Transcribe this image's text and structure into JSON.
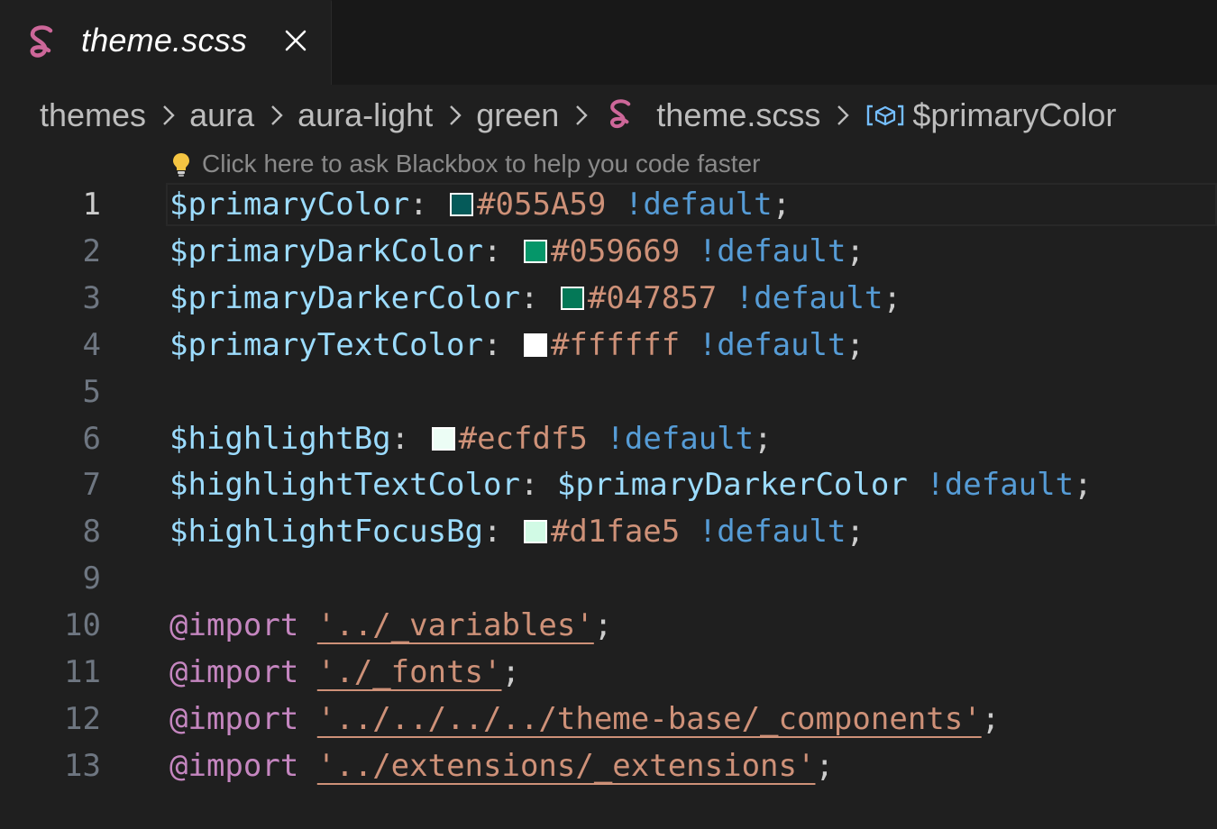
{
  "tab": {
    "title": "theme.scss"
  },
  "breadcrumb": {
    "items": [
      "themes",
      "aura",
      "aura-light",
      "green",
      "theme.scss",
      "$primaryColor"
    ]
  },
  "hint": {
    "text": "Click here to ask Blackbox to help you code faster"
  },
  "colors": {
    "sass_pink": "#cd6799",
    "variable": "#9cdcfe",
    "number": "#ce9178",
    "keyword": "#569cd6",
    "at_rule": "#c586c0"
  },
  "editor": {
    "current_line": 1,
    "lines": [
      {
        "n": "1",
        "var": "$primaryColor",
        "colon": ":",
        "swatch": "#055A59",
        "value": "#055A59",
        "flag": "!default",
        "semi": ";"
      },
      {
        "n": "2",
        "var": "$primaryDarkColor",
        "colon": ":",
        "swatch": "#059669",
        "value": "#059669",
        "flag": "!default",
        "semi": ";"
      },
      {
        "n": "3",
        "var": "$primaryDarkerColor",
        "colon": ":",
        "swatch": "#047857",
        "value": "#047857",
        "flag": "!default",
        "semi": ";"
      },
      {
        "n": "4",
        "var": "$primaryTextColor",
        "colon": ":",
        "swatch": "#ffffff",
        "value": "#ffffff",
        "flag": "!default",
        "semi": ";"
      },
      {
        "n": "5"
      },
      {
        "n": "6",
        "var": "$highlightBg",
        "colon": ":",
        "swatch": "#ecfdf5",
        "value": "#ecfdf5",
        "flag": "!default",
        "semi": ";"
      },
      {
        "n": "7",
        "var": "$highlightTextColor",
        "colon": ":",
        "ref": "$primaryDarkerColor",
        "flag": "!default",
        "semi": ";"
      },
      {
        "n": "8",
        "var": "$highlightFocusBg",
        "colon": ":",
        "swatch": "#d1fae5",
        "value": "#d1fae5",
        "flag": "!default",
        "semi": ";"
      },
      {
        "n": "9"
      },
      {
        "n": "10",
        "at": "@import",
        "path": "'../_variables'",
        "semi": ";"
      },
      {
        "n": "11",
        "at": "@import",
        "path": "'./_fonts'",
        "semi": ";"
      },
      {
        "n": "12",
        "at": "@import",
        "path": "'../../../../theme-base/_components'",
        "semi": ";"
      },
      {
        "n": "13",
        "at": "@import",
        "path": "'../extensions/_extensions'",
        "semi": ";"
      }
    ]
  }
}
